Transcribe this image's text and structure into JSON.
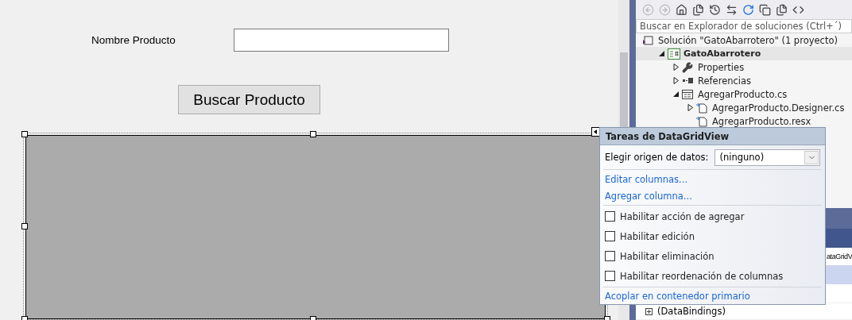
{
  "designer": {
    "label": "Nombre Producto",
    "button": "Buscar Producto"
  },
  "solution_explorer": {
    "search": {
      "placeholder": "Buscar en Explorador de soluciones (Ctrl+´)"
    },
    "tree": [
      {
        "label": "Solución \"GatoAbarrotero\"  (1 proyecto)",
        "kind": "solution",
        "bold": false,
        "children": [
          {
            "label": "GatoAbarrotero",
            "kind": "project",
            "bold": true,
            "expanded": true,
            "children": [
              {
                "label": "Properties",
                "kind": "wrench",
                "bold": false,
                "expanded": false
              },
              {
                "label": "Referencias",
                "kind": "references",
                "bold": false,
                "expanded": false
              },
              {
                "label": "AgregarProducto.cs",
                "kind": "form",
                "bold": false,
                "expanded": true,
                "children": [
                  {
                    "label": "AgregarProducto.Designer.cs",
                    "kind": "code",
                    "bold": false,
                    "expanded": false
                  },
                  {
                    "label": "AgregarProducto.resx",
                    "kind": "code",
                    "bold": false
                  }
                ]
              }
            ]
          }
        ]
      }
    ]
  },
  "properties": {
    "object_text": "ataGridV",
    "rows": [
      {
        "label": "(DataBindings)",
        "expanded": false
      }
    ]
  },
  "tasks": {
    "title": "Tareas de DataGridView",
    "source": {
      "label": "Elegir origen de datos:",
      "value": "(ninguno)"
    },
    "links": [
      "Editar columnas...",
      "Agregar columna..."
    ],
    "options": [
      {
        "label": "Habilitar acción de agregar",
        "checked": false
      },
      {
        "label": "Habilitar edición",
        "checked": false
      },
      {
        "label": "Habilitar eliminación",
        "checked": false
      },
      {
        "label": "Habilitar reordenación de columnas",
        "checked": false
      }
    ],
    "dock_link": "Acoplar en contenedor primario"
  }
}
